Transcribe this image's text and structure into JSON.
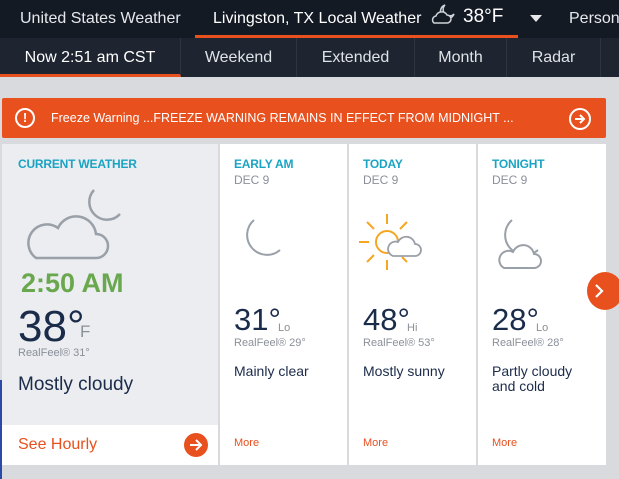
{
  "topbar": {
    "site_title": "United States Weather",
    "location": "Livingston, TX Local Weather",
    "location_icon": "partly-cloudy-night-icon",
    "current_temp": "38°F",
    "personal": "Person"
  },
  "subnav": {
    "tabs": [
      {
        "label": "Now 2:51 am CST",
        "active": true
      },
      {
        "label": "Weekend"
      },
      {
        "label": "Extended"
      },
      {
        "label": "Month"
      },
      {
        "label": "Radar"
      }
    ]
  },
  "warning": {
    "title": "Freeze Warning",
    "text": "...FREEZE WARNING REMAINS IN EFFECT FROM MIDNIGHT ...",
    "colors": {
      "background": "#e8501e"
    }
  },
  "current": {
    "header": "CURRENT WEATHER",
    "time": "2:50 AM",
    "temp": "38°",
    "unit": "F",
    "realfeel": "RealFeel® 31°",
    "condition": "Mostly cloudy",
    "icon": "mostly-cloudy-night-icon",
    "see_hourly": "See Hourly"
  },
  "forecast": [
    {
      "header": "EARLY AM",
      "date": "DEC 9",
      "icon": "clear-night-icon",
      "temp": "31°",
      "qualifier": "Lo",
      "realfeel": "RealFeel® 29°",
      "condition": "Mainly clear",
      "more": "More"
    },
    {
      "header": "TODAY",
      "date": "DEC 9",
      "icon": "mostly-sunny-icon",
      "temp": "48°",
      "qualifier": "Hi",
      "realfeel": "RealFeel® 53°",
      "condition": "Mostly sunny",
      "more": "More"
    },
    {
      "header": "TONIGHT",
      "date": "DEC 9",
      "icon": "partly-cloudy-night-icon",
      "temp": "28°",
      "qualifier": "Lo",
      "realfeel": "RealFeel® 28°",
      "condition": "Partly cloudy and cold",
      "more": "More"
    }
  ],
  "colors": {
    "accent": "#e8501e",
    "header_text": "#1aa4c4",
    "time_green": "#6aa84f",
    "dark_bg": "#141a24"
  }
}
